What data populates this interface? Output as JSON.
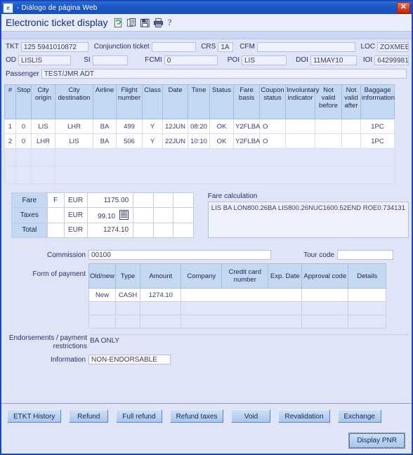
{
  "window": {
    "title": "- Diálogo de página Web",
    "icon": "internet-explorer-icon",
    "close_label": "✕"
  },
  "header": {
    "title": "Electronic ticket display",
    "icons": [
      "refresh-document-icon",
      "copy-document-icon",
      "save-icon",
      "print-icon",
      "help-icon"
    ],
    "help_glyph": "?"
  },
  "ticket_fields": {
    "tkt_label": "TKT",
    "tkt_value": "125 5941010872",
    "conjunction_label": "Conjunction ticket",
    "conjunction_value": "",
    "crs_label": "CRS",
    "crs_value": "1A",
    "cfm_label": "CFM",
    "cfm_value": "",
    "loc_label": "LOC",
    "loc_value": "ZOXMEE",
    "od_label": "OD",
    "od_value": "LISLIS",
    "si_label": "SI",
    "si_value": "",
    "fcmi_label": "FCMI",
    "fcmi_value": "0",
    "poi_label": "POI",
    "poi_value": "LIS",
    "doi_label": "DOI",
    "doi_value": "11MAY10",
    "ioi_label": "IOI",
    "ioi_value": "64299981",
    "passenger_label": "Passenger",
    "passenger_value": "TEST/JMR  ADT"
  },
  "coupon_table": {
    "headers": [
      "#",
      "Stop",
      "City origin",
      "City destination",
      "Airline",
      "Flight number",
      "Class",
      "Date",
      "Time",
      "Status",
      "Fare basis",
      "Coupon status",
      "Involuntary indicator",
      "Not valid before",
      "Not valid after",
      "Baggage information"
    ],
    "rows": [
      {
        "num": "1",
        "stop": "0",
        "city_origin": "LIS",
        "city_destination": "LHR",
        "airline": "BA",
        "flight_number": "499",
        "class": "Y",
        "date": "12JUN",
        "time": "08:20",
        "status": "OK",
        "fare_basis": "Y2FLBA",
        "coupon_status": "O",
        "involuntary": "",
        "not_valid_before": "",
        "not_valid_after": "",
        "baggage": "1PC"
      },
      {
        "num": "2",
        "stop": "0",
        "city_origin": "LHR",
        "city_destination": "LIS",
        "airline": "BA",
        "flight_number": "506",
        "class": "Y",
        "date": "22JUN",
        "time": "10:10",
        "status": "OK",
        "fare_basis": "Y2FLBA",
        "coupon_status": "O",
        "involuntary": "",
        "not_valid_before": "",
        "not_valid_after": "",
        "baggage": "1PC"
      }
    ],
    "empty_row_count": 2
  },
  "fare": {
    "fare_label": "Fare",
    "fare_indicator": "F",
    "fare_currency": "EUR",
    "fare_amount": "1175.00",
    "taxes_label": "Taxes",
    "taxes_indicator": "",
    "taxes_currency": "EUR",
    "taxes_amount": "99.10",
    "taxes_detail_icon": "tax-detail-list-icon",
    "total_label": "Total",
    "total_indicator": "",
    "total_currency": "EUR",
    "total_amount": "1274.10"
  },
  "fare_calculation": {
    "label": "Fare calculation",
    "value": "LIS BA LON800.26BA LIS800.26NUC1600.52END ROE0.734131"
  },
  "commission": {
    "label": "Commission",
    "value": "00100",
    "tour_code_label": "Tour code",
    "tour_code_value": ""
  },
  "form_of_payment": {
    "label": "Form of payment",
    "headers": [
      "Old/new",
      "Type",
      "Amount",
      "Company",
      "Credit card number",
      "Exp. Date",
      "Approval code",
      "Details"
    ],
    "rows": [
      {
        "old_new": "New",
        "type": "CASH",
        "amount": "1274.10",
        "company": "",
        "credit_card_number": "",
        "exp_date": "",
        "approval_code": "",
        "details": ""
      }
    ],
    "empty_row_count": 2
  },
  "endorsements": {
    "label_line1": "Endorsements / payment",
    "label_line2": "restrictions",
    "value": "BA ONLY",
    "information_label": "Information",
    "information_value": "NON-ENDORSABLE"
  },
  "footer": {
    "buttons": [
      "ETKT History",
      "Refund",
      "Full refund",
      "Refund taxes",
      "Void",
      "Revalidation",
      "Exchange"
    ],
    "display_pnr": "Display PNR"
  },
  "colors": {
    "titlebar": "#1a56c4",
    "accent_header": "#c5d8f1",
    "background": "#dfe4f7",
    "close_button": "#d83a1c",
    "text": "#29306b"
  }
}
